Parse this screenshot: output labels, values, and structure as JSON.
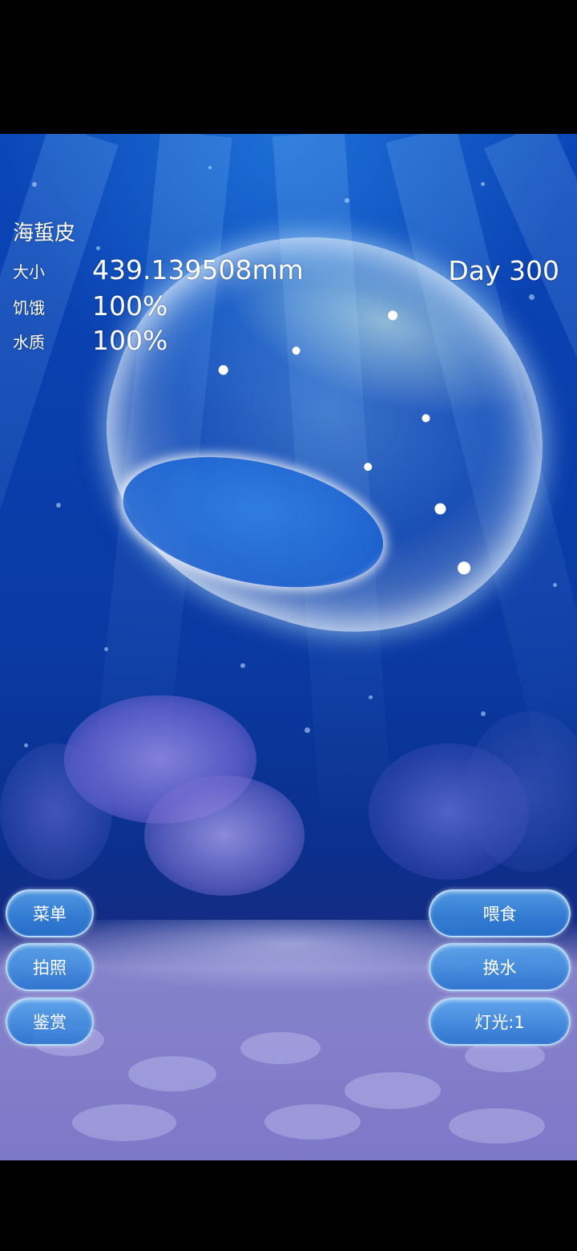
{
  "status": {
    "species_name": "海蜇皮",
    "size_label": "大小",
    "size_value": "439.139508mm",
    "hunger_label": "饥饿",
    "hunger_value": "100%",
    "water_label": "水质",
    "water_value": "100%",
    "day": "Day 300"
  },
  "left_buttons": {
    "menu": "菜单",
    "photo": "拍照",
    "appreciate": "鉴赏"
  },
  "right_buttons": {
    "feed": "喂食",
    "change_water": "换水",
    "light": "灯光:1"
  },
  "colors": {
    "water_top": "#0b47b8",
    "water_deep": "#0b2f8c",
    "floor": "#7d78c8",
    "button_fill": "#3a86d8",
    "coral": "#7e78d8"
  }
}
